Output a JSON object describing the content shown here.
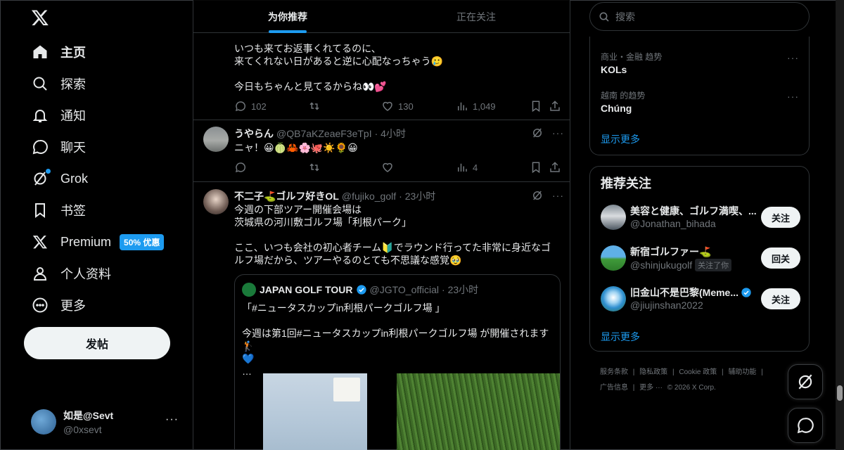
{
  "nav": {
    "items": [
      {
        "label": "主页",
        "icon": "home-icon"
      },
      {
        "label": "探索",
        "icon": "search-icon"
      },
      {
        "label": "通知",
        "icon": "bell-icon"
      },
      {
        "label": "聊天",
        "icon": "chat-icon"
      },
      {
        "label": "Grok",
        "icon": "grok-icon"
      },
      {
        "label": "书签",
        "icon": "bookmark-icon"
      },
      {
        "label": "Premium",
        "icon": "x-logo-icon",
        "badge": "50% 优惠"
      },
      {
        "label": "个人资料",
        "icon": "person-icon"
      },
      {
        "label": "更多",
        "icon": "more-circle-icon"
      }
    ],
    "post_button": "发帖",
    "account": {
      "name": "如是@Sevt",
      "handle": "@0xsevt"
    }
  },
  "tabs": {
    "for_you": "为你推荐",
    "following": "正在关注"
  },
  "tweets": [
    {
      "text": "いつも来てお返事くれてるのに、\n来てくれない日があると逆に心配なっちゃう🥲\n\n今日もちゃんと見てるからね👀💕",
      "replies": "102",
      "likes": "130",
      "views": "1,049"
    },
    {
      "name": "うやらん",
      "handle": "@QB7aKZeaeF3eTpI",
      "time": "· 4小时",
      "text": "ニャ！😀🍈🦀🌸🐙☀️🌻😀",
      "views": "4"
    },
    {
      "name": "不二子⛳ゴルフ好きOL",
      "handle": "@fujiko_golf",
      "time": "· 23小时",
      "text": "今週の下部ツアー開催会場は\n茨城県の河川敷ゴルフ場「利根パーク」\n\nここ、いつも会社の初心者チーム🔰でラウンド行ってた非常に身近なゴルフ場だから、ツアーやるのとても不思議な感覚🥹",
      "quote": {
        "name": "JAPAN GOLF TOUR",
        "handle": "@JGTO_official",
        "time": "· 23小时",
        "text": "「#ニュータスカップin利根パークゴルフ場 」\n\n今週は第1回#ニュータスカップin利根パークゴルフ場 が開催されます🏌️\n💙\n…"
      }
    }
  ],
  "sidebar": {
    "search_placeholder": "搜索",
    "trends": [
      {
        "category": "商业・金融 趋势",
        "name": "KOLs"
      },
      {
        "category": "越南 的趋势",
        "name": "Chúng"
      }
    ],
    "trends_show_more": "显示更多",
    "who_to_follow_title": "推荐关注",
    "who_to_follow": [
      {
        "name": "美容と健康、ゴルフ満喫、...",
        "handle": "@Jonathan_bihada",
        "button": "关注"
      },
      {
        "name": "新宿ゴルファー⛳",
        "handle": "@shinjukugolf",
        "follows_you": "关注了你",
        "button": "回关"
      },
      {
        "name": "旧金山不是巴黎(Meme...",
        "handle": "@jiujinshan2022",
        "button": "关注",
        "verified": true
      }
    ],
    "follow_show_more": "显示更多",
    "footer": {
      "line1": [
        "服务条款",
        "|",
        "隐私政策",
        "|",
        "Cookie 政策",
        "|",
        "辅助功能",
        "|"
      ],
      "line2": [
        "广告信息",
        "|",
        "更多 ···",
        "© 2026 X Corp."
      ]
    }
  },
  "colors": {
    "accent": "#1d9bf0",
    "background": "#000000",
    "border": "#2f3336",
    "muted": "#71767b",
    "text": "#e7e9ea"
  }
}
